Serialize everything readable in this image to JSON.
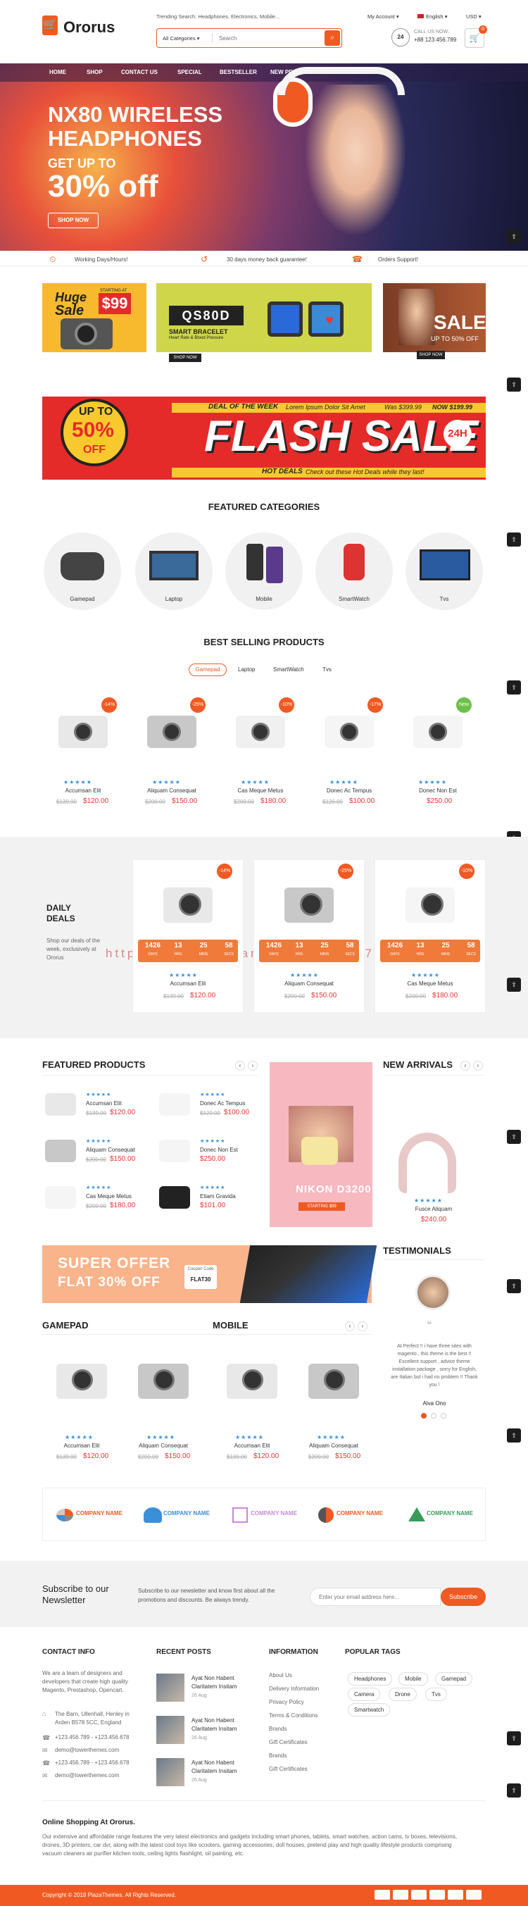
{
  "header": {
    "logo": "Ororus",
    "trending": "Trending Search: Headphones, Electronics, Mobile...",
    "account": "My Account",
    "language": "English",
    "currency": "USD",
    "category_select": "All Categories",
    "search_placeholder": "Search",
    "phone_label": "CALL US NOW:",
    "phone": "+88 123.456.789",
    "cart_count": "0"
  },
  "nav": [
    "HOME",
    "SHOP",
    "CONTACT US",
    "SPECIAL",
    "BESTSELLER",
    "NEW PRODUCTS"
  ],
  "hero": {
    "title1": "NX80 WIRELESS",
    "title2": "HEADPHONES",
    "sub": "GET UP TO",
    "percent": "30% off",
    "button": "SHOP NOW"
  },
  "features": [
    "Working Days/Hours!",
    "30 days money back guarantee!",
    "Orders Support!"
  ],
  "banners": {
    "huge": "Huge",
    "sale": "Sale",
    "starting": "STARTING AT",
    "price": "$99",
    "bracelet_title": "QS80D",
    "bracelet_sub": "SMART BRACELET",
    "bracelet_sub2": "Heart Rate & Blood Pressure",
    "bracelet_btn": "SHOP NOW",
    "sale_title": "SALE",
    "sale_sub": "UP TO 50% OFF",
    "sale_btn": "SHOP NOW"
  },
  "flash": {
    "up_to": "UP TO",
    "percent": "50%",
    "off": "OFF",
    "deal_of_week": "DEAL OF THE WEEK",
    "lorem": "Lorem Ipsum Dolor Sit Amet",
    "was": "Was $399.99",
    "now": "NOW $199.99",
    "flash_sale": "FLASH SALE",
    "h24": "24H",
    "hot_deals": "HOT DEALS",
    "hot_text": "Check out these Hot Deals while they last!"
  },
  "featured_categories": {
    "title": "FEATURED CATEGORIES",
    "items": [
      "Gamepad",
      "Laptop",
      "Mobile",
      "SmartWatch",
      "Tvs"
    ]
  },
  "best_selling": {
    "title": "BEST SELLING PRODUCTS",
    "tabs": [
      "Gamepad",
      "Laptop",
      "SmartWatch",
      "Tvs"
    ],
    "products": [
      {
        "name": "Accumsan Elit",
        "old": "$139.00",
        "price": "$120.00",
        "badge": "-14%"
      },
      {
        "name": "Aliquam Consequat",
        "old": "$200.00",
        "price": "$150.00",
        "badge": "-25%"
      },
      {
        "name": "Cas Meque Metus",
        "old": "$200.00",
        "price": "$180.00",
        "badge": "-10%"
      },
      {
        "name": "Donec Ac Tempus",
        "old": "$120.00",
        "price": "$100.00",
        "badge": "-17%"
      },
      {
        "name": "Donec Non Est",
        "old": "",
        "price": "$250.00",
        "badge": "New"
      }
    ]
  },
  "daily_deals": {
    "title1": "DAILY",
    "title2": "DEALS",
    "desc": "Shop our deals of the week, exclusively at Ororus",
    "watermark": "https://www.huzhan.com/ishop3572",
    "products": [
      {
        "name": "Accumsan Elit",
        "old": "$139.00",
        "price": "$120.00",
        "badge": "-14%",
        "cd": [
          "1426",
          "13",
          "25",
          "58"
        ]
      },
      {
        "name": "Aliquam Consequat",
        "old": "$200.00",
        "price": "$150.00",
        "badge": "-25%",
        "cd": [
          "1426",
          "13",
          "25",
          "58"
        ]
      },
      {
        "name": "Cas Meque Metus",
        "old": "$200.00",
        "price": "$180.00",
        "badge": "-10%",
        "cd": [
          "1426",
          "13",
          "25",
          "58"
        ]
      }
    ],
    "cd_labels": [
      "DAYS",
      "HRS",
      "MINS",
      "SECS"
    ]
  },
  "featured_products": {
    "title": "FEATURED PRODUCTS",
    "items": [
      {
        "name": "Accumsan Elit",
        "old": "$139.00",
        "price": "$120.00"
      },
      {
        "name": "Donec Ac Tempus",
        "old": "$120.00",
        "price": "$100.00"
      },
      {
        "name": "Aliquam Consequat",
        "old": "$200.00",
        "price": "$150.00"
      },
      {
        "name": "Donec Non Est",
        "old": "",
        "price": "$250.00"
      },
      {
        "name": "Cas Meque Metus",
        "old": "$200.00",
        "price": "$180.00"
      },
      {
        "name": "Etiam Gravida",
        "old": "",
        "price": "$101.00"
      }
    ]
  },
  "nikon": {
    "title": "NIKON D3200",
    "sub": "STARTING $99"
  },
  "new_arrivals": {
    "title": "NEW ARRIVALS",
    "name": "Fusce Aliquam",
    "price": "$240.00"
  },
  "super_offer": {
    "line1": "SUPER OFFER",
    "line2": "FLAT 30% OFF",
    "coupon_label": "Coupon Code",
    "coupon": "FLAT30"
  },
  "testimonials": {
    "title": "TESTIMONIALS",
    "text": "At Perfect !! i have three sites with magento , this theme is the best !! Excellent support , advice theme installation package , sorry for English, are Italian but i had no problem !! Thank you !",
    "author": "Alva Ono"
  },
  "gamepad": {
    "title": "GAMEPAD",
    "items": [
      {
        "name": "Accumsan Elit",
        "old": "$139.00",
        "price": "$120.00"
      },
      {
        "name": "Aliquam Consequat",
        "old": "$200.00",
        "price": "$150.00"
      }
    ]
  },
  "mobile": {
    "title": "MOBILE",
    "items": [
      {
        "name": "Accumsan Elit",
        "old": "$139.00",
        "price": "$120.00"
      },
      {
        "name": "Aliquam Consequat",
        "old": "$200.00",
        "price": "$150.00"
      }
    ]
  },
  "partners": [
    "COMPANY NAME",
    "COMPANY NAME",
    "COMPANY NAME",
    "COMPANY NAME",
    "COMPANY NAME"
  ],
  "subscribe": {
    "title1": "Subscribe to our",
    "title2": "Newsletter",
    "desc": "Subscribe to our newsletter and know first about all the promotions and discounts. Be always trendy.",
    "placeholder": "Enter your email address here...",
    "button": "Subscribe"
  },
  "footer": {
    "contact": {
      "title": "CONTACT INFO",
      "desc": "We are a team of designers and developers that create high quality Magento, Prestashop, Opencart.",
      "address": "The Barn, Ullenhall, Henley in Arden B578 5CC, England",
      "phone1": "+123.456.789 - +123.456.678",
      "email1": "demo@towerthemes.com",
      "phone2": "+123.456.789 - +123.456.678",
      "email2": "demo@towerthemes.com"
    },
    "recent": {
      "title": "RECENT POSTS",
      "posts": [
        {
          "t1": "Ayat Non Habent",
          "t2": "Claritatem Insitam",
          "date": "26 Aug"
        },
        {
          "t1": "Ayat Non Habent",
          "t2": "Claritatem Insitam",
          "date": "26 Aug"
        },
        {
          "t1": "Ayat Non Habent",
          "t2": "Claritatem Insitam",
          "date": "26 Aug"
        }
      ]
    },
    "info": {
      "title": "INFORMATION",
      "links": [
        "About Us",
        "Delivery Information",
        "Privacy Policy",
        "Terms & Conditions",
        "Brands",
        "Gift Certificates",
        "Brands",
        "Gift Certificates"
      ]
    },
    "tags": {
      "title": "POPULAR TAGS",
      "items": [
        "Headphones",
        "Mobile",
        "Gamepad",
        "Camera",
        "Drone",
        "Tvs",
        "Smartwatch"
      ]
    },
    "about_title": "Online Shopping At Ororus.",
    "about_text": "Our extensive and affordable range features the very latest electronics and gadgets including smart phones, tablets, smart watches, action cams, tv boxes, televisions, drones, 3D printers, car dvr, along with the latest cool toys like scooters, gaming accessories, doll houses, pretend play and high quality lifestyle products comprising vacuum cleaners air purifier kitchen tools, ceiling lights flashlight, oil painting, etc.",
    "copyright": "Copyright © 2018 PlazaThemes. All Rights Reserved."
  }
}
